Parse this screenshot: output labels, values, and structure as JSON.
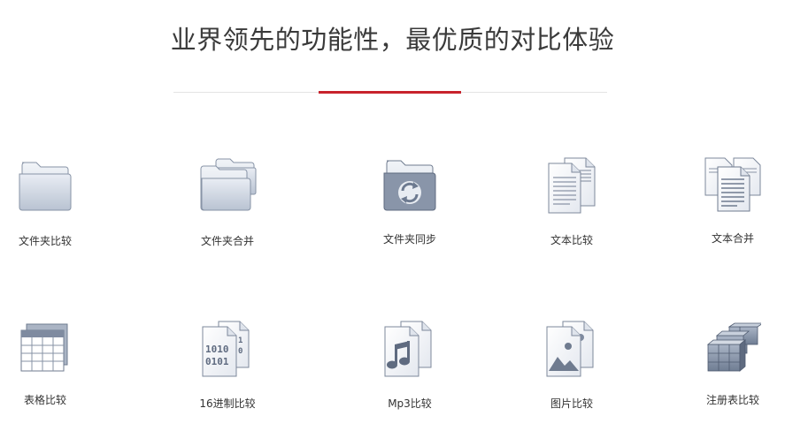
{
  "header": {
    "title": "业界领先的功能性，最优质的对比体验"
  },
  "colors": {
    "accent": "#c8232c",
    "icon_dark": "#7a879c",
    "icon_light": "#e3e8f0"
  },
  "features": [
    {
      "label": "文件夹比较",
      "icon": "folder-icon"
    },
    {
      "label": "文件夹合并",
      "icon": "folders-icon"
    },
    {
      "label": "文件夹同步",
      "icon": "folder-sync-icon"
    },
    {
      "label": "文本比较",
      "icon": "text-documents-icon"
    },
    {
      "label": "文本合并",
      "icon": "text-merge-icon"
    },
    {
      "label": "表格比较",
      "icon": "table-icon"
    },
    {
      "label": "16进制比较",
      "icon": "binary-file-icon"
    },
    {
      "label": "Mp3比较",
      "icon": "music-file-icon"
    },
    {
      "label": "图片比较",
      "icon": "image-file-icon"
    },
    {
      "label": "注册表比较",
      "icon": "registry-cubes-icon"
    }
  ]
}
